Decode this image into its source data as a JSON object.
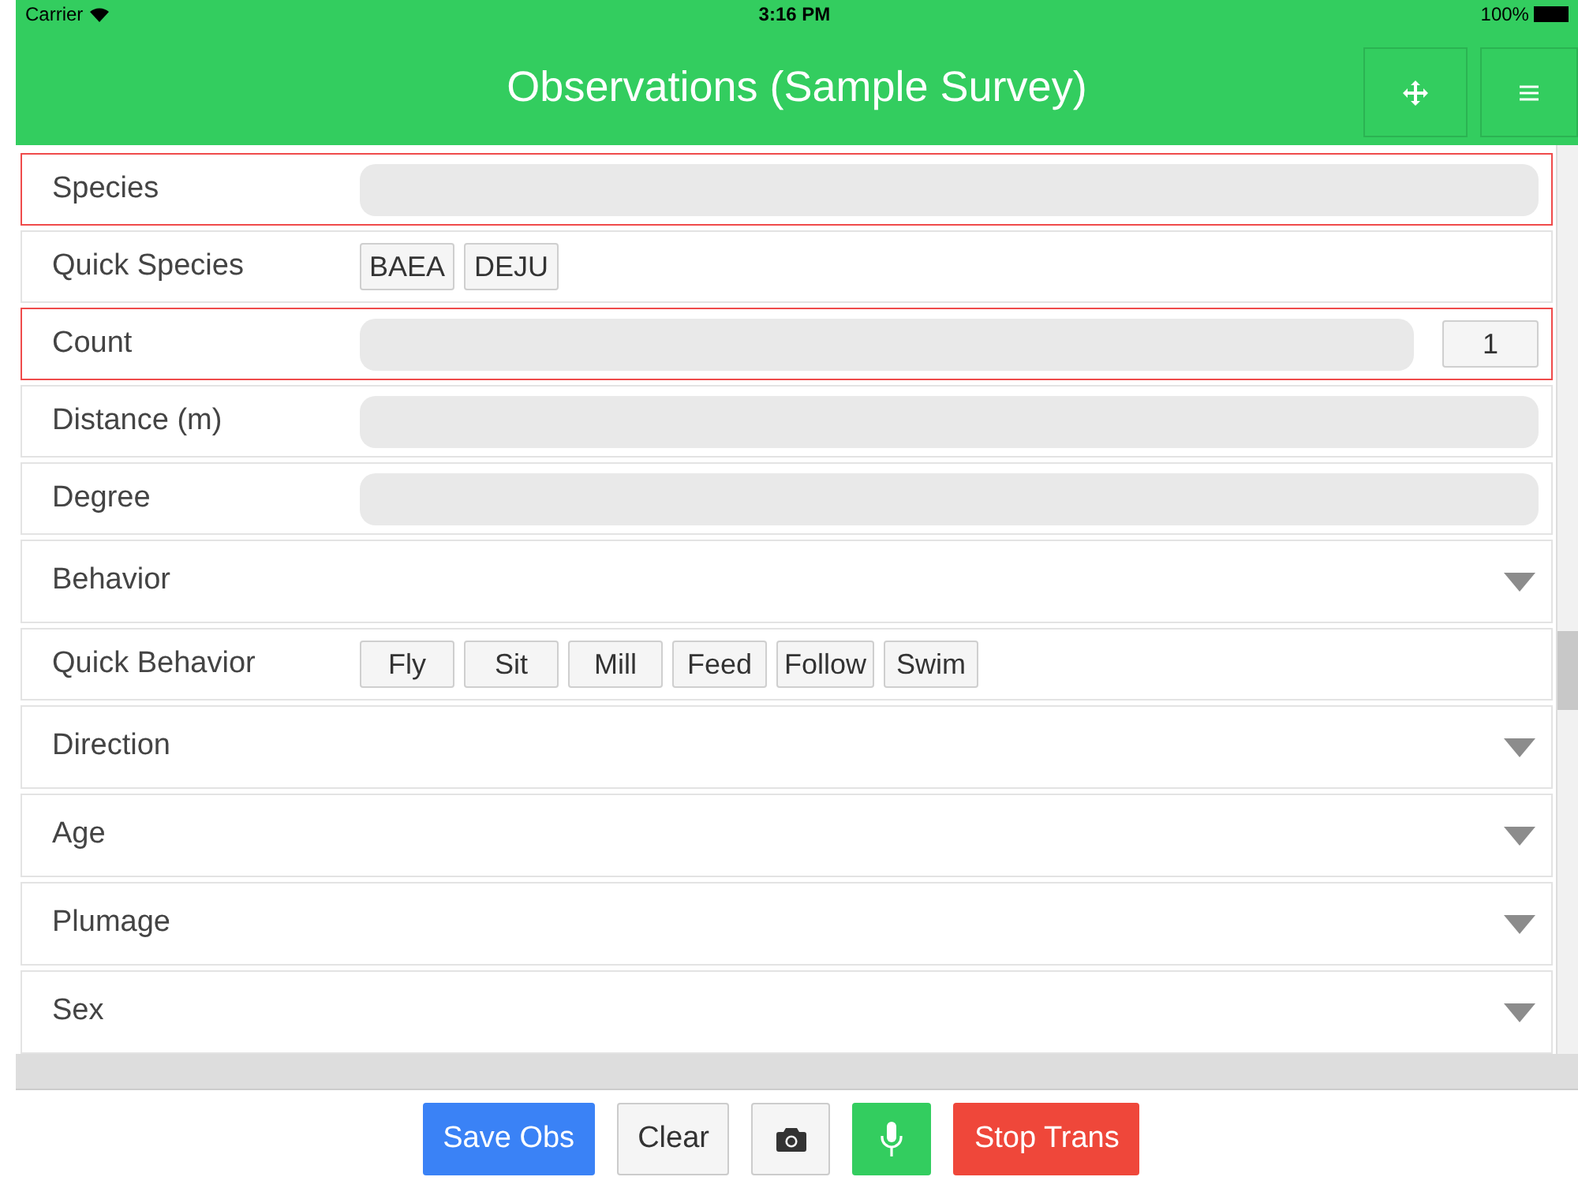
{
  "status_bar": {
    "carrier": "Carrier",
    "time": "3:16 PM",
    "battery": "100%"
  },
  "header": {
    "title": "Observations (Sample Survey)"
  },
  "rows": [
    {
      "kind": "text",
      "label": "Species",
      "invalid": true
    },
    {
      "kind": "chips",
      "label": "Quick Species",
      "chips": [
        "BAEA",
        "DEJU"
      ],
      "invalid": false
    },
    {
      "kind": "count",
      "label": "Count",
      "count": "1",
      "invalid": true
    },
    {
      "kind": "text",
      "label": "Distance (m)",
      "invalid": false
    },
    {
      "kind": "text",
      "label": "Degree",
      "invalid": false
    },
    {
      "kind": "select",
      "label": "Behavior",
      "invalid": false
    },
    {
      "kind": "chips",
      "label": "Quick Behavior",
      "chips": [
        "Fly",
        "Sit",
        "Mill",
        "Feed",
        "Follow",
        "Swim"
      ],
      "invalid": false
    },
    {
      "kind": "select",
      "label": "Direction",
      "invalid": false
    },
    {
      "kind": "select",
      "label": "Age",
      "invalid": false
    },
    {
      "kind": "select",
      "label": "Plumage",
      "invalid": false
    },
    {
      "kind": "select",
      "label": "Sex",
      "invalid": false
    }
  ],
  "footer": [
    {
      "kind": "primary",
      "label": "Save Obs"
    },
    {
      "kind": "default",
      "label": "Clear"
    },
    {
      "kind": "camera"
    },
    {
      "kind": "mic"
    },
    {
      "kind": "danger",
      "label": "Stop Trans"
    }
  ]
}
